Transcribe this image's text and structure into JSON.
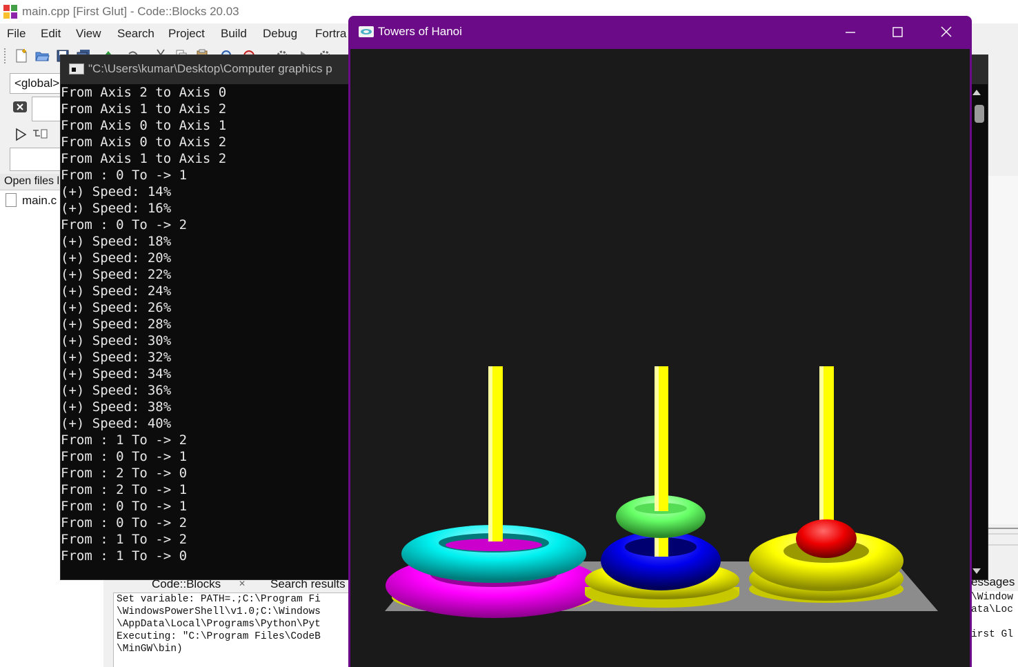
{
  "codeblocks": {
    "title": "main.cpp [First Glut] - Code::Blocks 20.03",
    "menu": [
      "File",
      "Edit",
      "View",
      "Search",
      "Project",
      "Build",
      "Debug",
      "Fortra"
    ],
    "scope_value": "<global>",
    "open_files_header": "Open files li",
    "open_file": "main.c",
    "log_tabs": [
      "Code::Blocks",
      "Search results"
    ],
    "messages_tab": "essages",
    "log_text": "Set variable: PATH=.;C:\\Program Fi\n\\WindowsPowerShell\\v1.0;C:\\Windows\n\\AppData\\Local\\Programs\\Python\\Pyt\nExecuting: \"C:\\Program Files\\CodeB\n\\MinGW\\bin)",
    "log_text_right": "\\Window\nata\\Loc\n\nirst Gl"
  },
  "console": {
    "title": "\"C:\\Users\\kumar\\Desktop\\Computer graphics p",
    "lines": [
      "From Axis 2 to Axis 0",
      "From Axis 1 to Axis 2",
      "From Axis 0 to Axis 1",
      "From Axis 0 to Axis 2",
      "From Axis 1 to Axis 2",
      "From : 0 To -> 1",
      "(+) Speed: 14%",
      "(+) Speed: 16%",
      "From : 0 To -> 2",
      "(+) Speed: 18%",
      "(+) Speed: 20%",
      "(+) Speed: 22%",
      "(+) Speed: 24%",
      "(+) Speed: 26%",
      "(+) Speed: 28%",
      "(+) Speed: 30%",
      "(+) Speed: 32%",
      "(+) Speed: 34%",
      "(+) Speed: 36%",
      "(+) Speed: 38%",
      "(+) Speed: 40%",
      "From : 1 To -> 2",
      "From : 0 To -> 1",
      "From : 2 To -> 0",
      "From : 2 To -> 1",
      "From : 0 To -> 1",
      "From : 0 To -> 2",
      "From : 1 To -> 2",
      "From : 1 To -> 0"
    ]
  },
  "hanoi": {
    "title": "Towers of Hanoi",
    "colors": {
      "titlebar": "#6b0b88",
      "background": "#1a1a1a",
      "base": "#8c8c8c",
      "rod": "#ffff00",
      "disk_magenta": "#ff00ff",
      "disk_cyan": "#00ffff",
      "disk_blue": "#0000ff",
      "disk_green": "#66ff66",
      "disk_yellow": "#ffff00",
      "disk_red": "#ff0000"
    },
    "rods": [
      {
        "name": "rod-0",
        "disks_bottom_to_top": [
          "yellow",
          "magenta",
          "cyan"
        ]
      },
      {
        "name": "rod-1",
        "disks_bottom_to_top": [
          "yellow",
          "blue",
          "green"
        ]
      },
      {
        "name": "rod-2",
        "disks_bottom_to_top": [
          "yellow",
          "yellow",
          "red"
        ]
      }
    ]
  }
}
